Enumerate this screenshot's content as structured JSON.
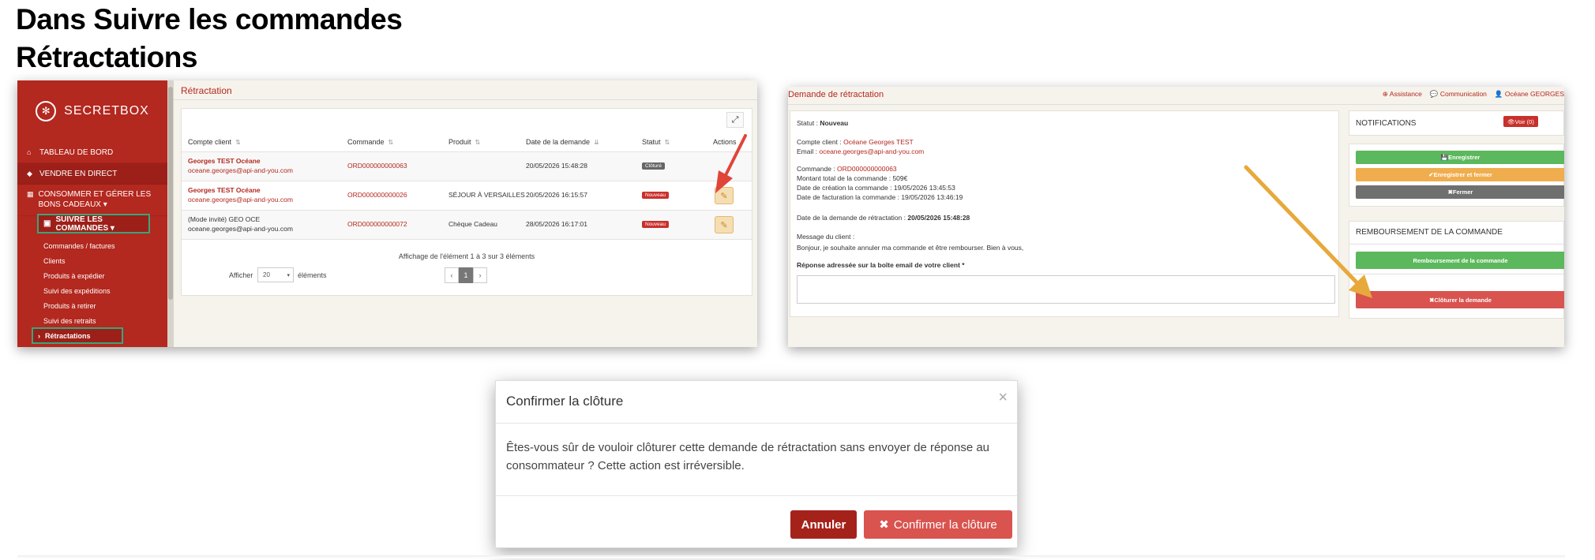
{
  "headings": {
    "line1": "Dans Suivre les commandes",
    "line2": "Rétractations"
  },
  "screen1": {
    "brand": "SECRETBOX",
    "nav": [
      {
        "label": "TABLEAU DE BORD",
        "icon": "home-icon"
      },
      {
        "label": "VENDRE EN DIRECT",
        "icon": "tag-icon"
      },
      {
        "label": "CONSOMMER ET GÉRER LES BONS CADEAUX ▾",
        "icon": "grid-icon"
      }
    ],
    "nav_selected": "SUIVRE LES COMMANDES ▾",
    "submenu": [
      "Commandes / factures",
      "Clients",
      "Produits à expédier",
      "Suivi des expéditions",
      "Produits à retirer",
      "Suivi des retraits"
    ],
    "submenu_selected": "Rétractations",
    "page_title": "Rétractation",
    "columns": [
      "Compte client",
      "Commande",
      "Produit",
      "Date de la demande",
      "Statut",
      "Actions"
    ],
    "rows": [
      {
        "client": "Georges TEST Océane",
        "email": "oceane.georges@api-and-you.com",
        "order": "ORD000000000063",
        "product": "",
        "date": "20/05/2026 15:48:28",
        "status": "Clôturé",
        "status_color": "#666666"
      },
      {
        "client": "Georges TEST Océane",
        "email": "oceane.georges@api-and-you.com",
        "order": "ORD000000000026",
        "product": "SÉJOUR À VERSAILLES",
        "date": "20/05/2026 16:15:57",
        "status": "Nouveau",
        "status_color": "#c9302c"
      },
      {
        "client": "(Mode invité) GEO OCE",
        "email": "oceane.georges@api-and-you.com",
        "order": "ORD000000000072",
        "product": "Chèque Cadeau",
        "date": "28/05/2026 16:17:01",
        "status": "Nouveau",
        "status_color": "#c9302c"
      }
    ],
    "info": "Affichage de l'élément 1 à 3 sur 3 éléments",
    "show_label": "Afficher",
    "show_value": "20",
    "show_suffix": "éléments",
    "pager": {
      "prev": "‹",
      "current": "1",
      "next": "›"
    }
  },
  "screen2": {
    "title": "Demande de rétractation",
    "top_links": [
      "Assistance",
      "Communication",
      "Océane GEORGES"
    ],
    "status_label": "Statut :",
    "status_value": "Nouveau",
    "client_label": "Compte client :",
    "client_value": "Océane Georges TEST",
    "email_label": "Email :",
    "email_value": "oceane.georges@api-and-you.com",
    "order_label": "Commande :",
    "order_value": "ORD000000000063",
    "total_label": "Montant total de la commande :",
    "total_value": "509€",
    "created_label": "Date de création la commande :",
    "created_value": "19/05/2026 13:45:53",
    "billed_label": "Date de facturation la commande :",
    "billed_value": "19/05/2026 13:46:19",
    "request_label": "Date de la demande de rétractation :",
    "request_value": "20/05/2026 15:48:28",
    "message_label": "Message du client :",
    "message_value": "Bonjour, je souhaite annuler ma commande et être rembourser. Bien à vous,",
    "reply_label": "Réponse adressée sur la boîte email de votre client *",
    "notifications": "NOTIFICATIONS",
    "voir": "Voir (0)",
    "btn_save": "Enregistrer",
    "btn_save_close": "Enregistrer et fermer",
    "btn_close": "Fermer",
    "refund_title": "REMBOURSEMENT DE LA COMMANDE",
    "btn_refund": "Remboursement de la commande",
    "btn_cloture": "Clôturer la demande"
  },
  "modal": {
    "title": "Confirmer la clôture",
    "close": "×",
    "body": "Êtes-vous sûr de vouloir clôturer cette demande de rétractation sans envoyer de réponse au consommateur ? Cette action est irréversible.",
    "cancel": "Annuler",
    "confirm": "Confirmer la clôture"
  },
  "colors": {
    "brand_red": "#b3281f",
    "selection_outline": "#3aa57a",
    "arrow_red": "#e0453a",
    "arrow_orange": "#e7a93b"
  }
}
